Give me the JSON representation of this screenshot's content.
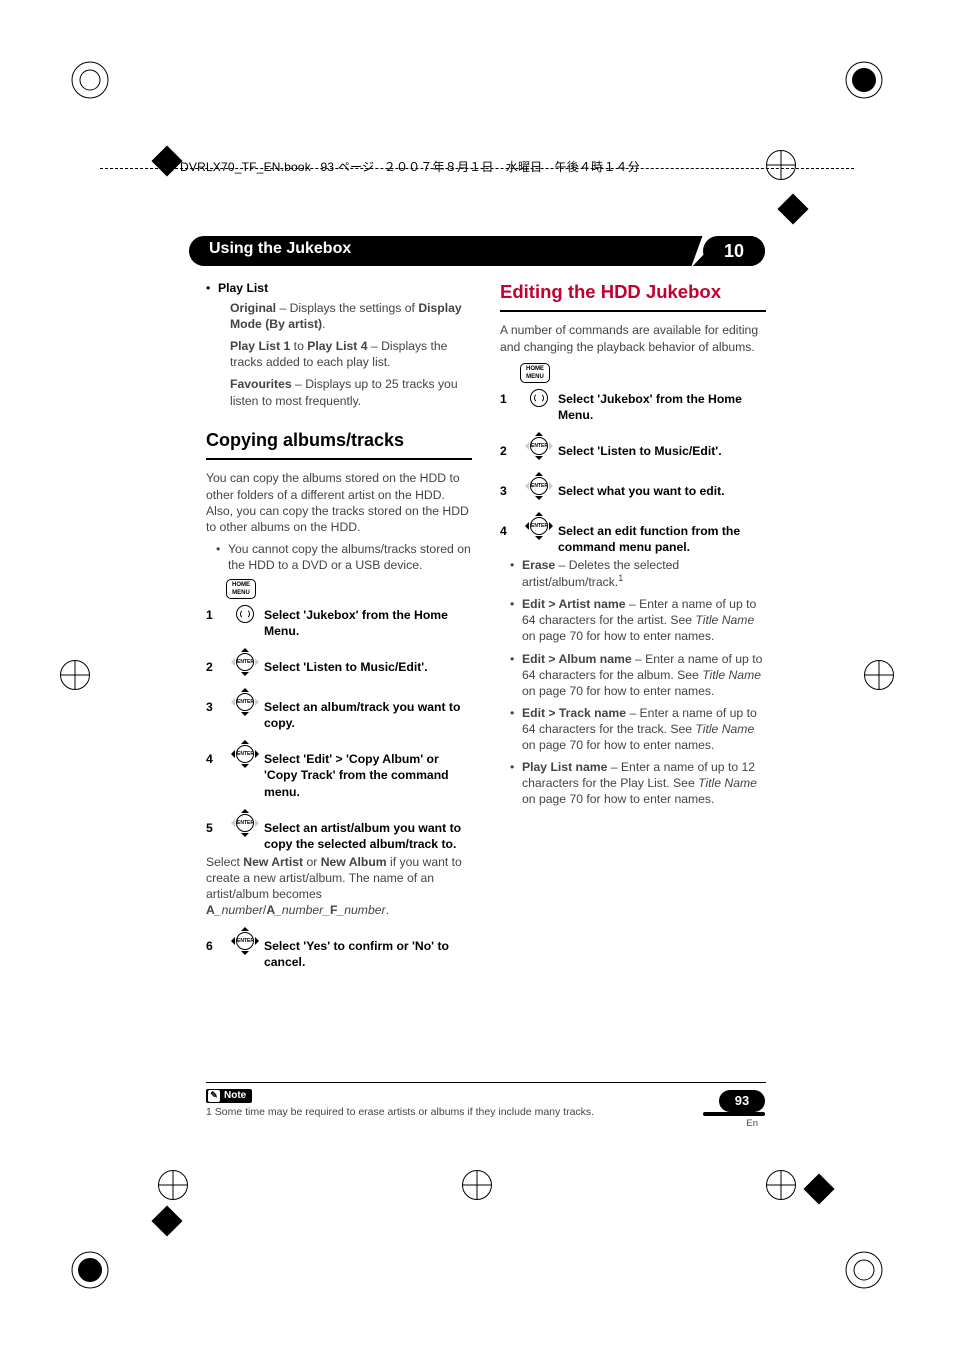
{
  "header": {
    "file": "DVRLX70_TF_EN.book",
    "page_fragment": "93 ページ",
    "date": "２００７年８月１日　水曜日　午後４時１４分"
  },
  "chapter": {
    "title": "Using the Jukebox",
    "number": "10"
  },
  "left": {
    "playlist_label": "Play List",
    "original_b": "Original",
    "original_rest": " – Displays the settings of ",
    "display_mode": "Display Mode (By artist)",
    "pl_a": "Play List 1",
    "pl_to": " to ",
    "pl_b": "Play List 4",
    "pl_rest": " – Displays the tracks added to each play list.",
    "fav_b": "Favourites",
    "fav_rest": " – Displays up to 25 tracks you listen to most frequently.",
    "h_copy": "Copying albums/tracks",
    "copy_intro": "You can copy the albums stored on the HDD to other folders of a different artist on the HDD. Also, you can copy the tracks stored on the HDD to other albums on the HDD.",
    "copy_note": "You cannot copy the albums/tracks stored on the HDD to a DVD or a USB device.",
    "s1": "Select 'Jukebox' from the Home Menu.",
    "s2": "Select 'Listen to Music/Edit'.",
    "s3": "Select an album/track you want to copy.",
    "s4": "Select 'Edit' > 'Copy Album' or 'Copy Track' from the command menu.",
    "s5": "Select an artist/album you want to copy the selected album/track to.",
    "s5b_a": "Select ",
    "s5b_b": "New Artist",
    "s5b_c": " or ",
    "s5b_d": "New Album",
    "s5b_e": " if you want to create a new artist/album. The name of an artist/album becomes ",
    "s5b_f": "A",
    "s5b_g": "_number",
    "s5b_h": "/",
    "s5b_i": "A",
    "s5b_j": "_number_",
    "s5b_k": "F",
    "s5b_l": "_number",
    "s5b_m": ".",
    "s6": "Select 'Yes' to confirm or 'No' to cancel."
  },
  "right": {
    "h_edit": "Editing the HDD Jukebox",
    "intro": "A number of commands are available for editing and changing the playback behavior of albums.",
    "s1": "Select 'Jukebox' from the Home Menu.",
    "s2": "Select 'Listen to Music/Edit'.",
    "s3": "Select what you want to edit.",
    "s4": "Select an edit function from the command menu panel.",
    "erase_b": "Erase",
    "erase_rest": " – Deletes the selected artist/album/track.",
    "art_b": "Edit > Artist name",
    "art_rest_a": " – Enter a name of up to 64 characters for the artist. See ",
    "title_name": "Title Name",
    "onpage70": " on page 70 for how to enter names.",
    "alb_b": "Edit > Album name",
    "alb_rest_a": " – Enter a name of up to 64 characters for the album. See ",
    "trk_b": "Edit > Track name",
    "trk_rest_a": " – Enter a name of up to 64 characters for the track. See ",
    "pl_b": "Play List name",
    "pl_rest_a": " – Enter a name of up to 12 characters for the Play List. See "
  },
  "note": {
    "label": "Note",
    "text": "1 Some time may be required to erase artists or albums if they include many tracks."
  },
  "page": {
    "num": "93",
    "lang": "En"
  },
  "icons": {
    "home": "HOME\nMENU",
    "enter": "ENTER",
    "pencil": "✎"
  }
}
